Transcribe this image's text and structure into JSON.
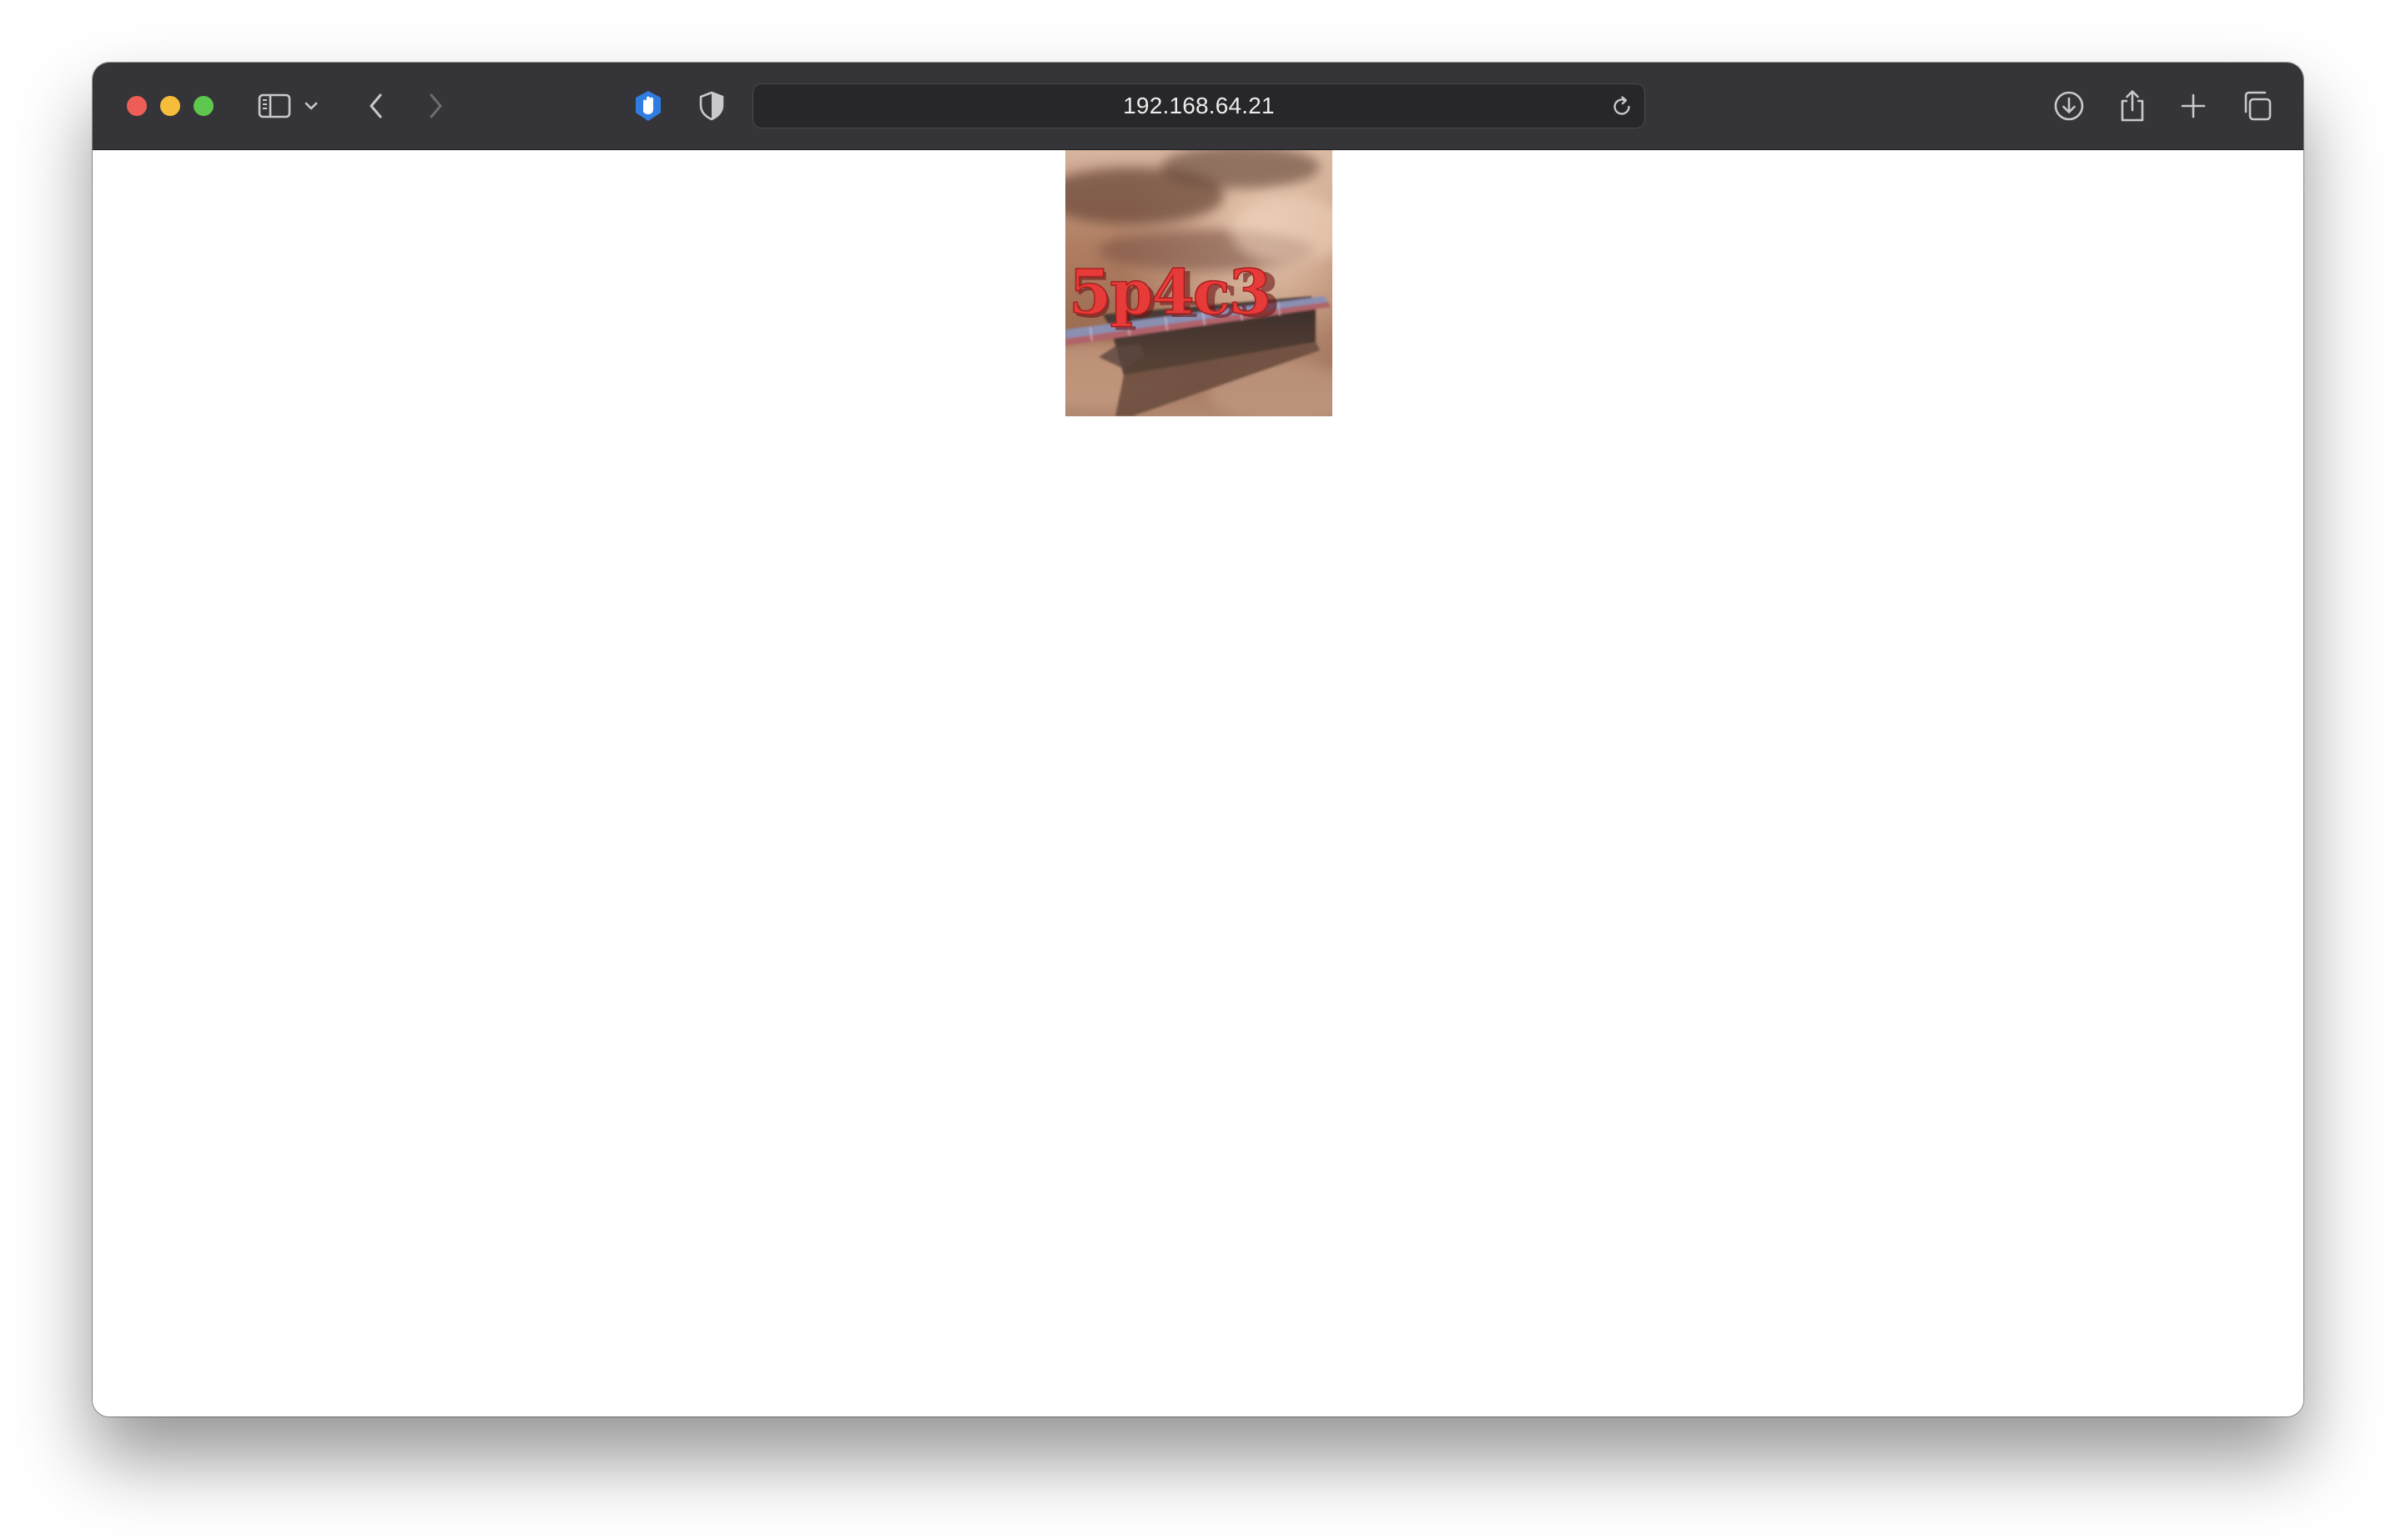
{
  "browser": {
    "address": {
      "url": "192.168.64.21"
    }
  },
  "page": {
    "image": {
      "text": "5p4c3"
    }
  },
  "colors": {
    "toolbar": "#353438",
    "close": "#ee5e57",
    "minimize": "#f6bd3b",
    "zoom": "#5ec74d",
    "extension_accent": "#3b82f6"
  }
}
